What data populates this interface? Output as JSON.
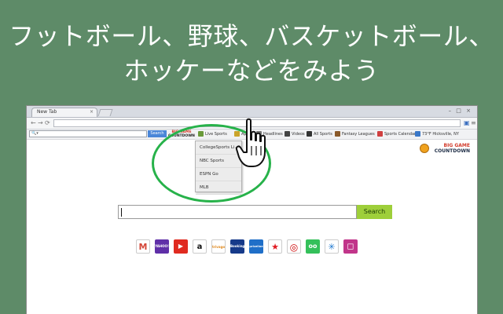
{
  "headline": {
    "line1": "フットボール、野球、バスケットボール、",
    "line2": "ホッケーなどをみよう"
  },
  "browser": {
    "tab_title": "New Tab",
    "tab_close": "×",
    "window_controls": "– □ ×"
  },
  "toolbar": {
    "search_placeholder": "🔍▾",
    "search_button": "Search",
    "logo_top": "BIG GAME",
    "logo_bottom": "COUNTDOWN",
    "items": [
      {
        "label": "Live Sports",
        "icon_color": "#6a9a3a"
      },
      {
        "label": "Apps",
        "icon_color": "#caa42b"
      },
      {
        "label": "Headlines",
        "icon_color": "#777777"
      },
      {
        "label": "Videos",
        "icon_color": "#444444"
      },
      {
        "label": "All Sports",
        "icon_color": "#333333"
      },
      {
        "label": "Fantasy Leagues",
        "icon_color": "#8a5a2a"
      },
      {
        "label": "Sports Calendar",
        "icon_color": "#d04040"
      },
      {
        "label": "73°F Hicksville, NY",
        "icon_color": "#3a78c8"
      }
    ]
  },
  "dropdown": {
    "items": [
      "CollegeSports Li...",
      "NBC Sports",
      "ESPN Go",
      "MLB"
    ]
  },
  "brand_logo": {
    "line1": "BIG GAME",
    "line2": "COUNTDOWN"
  },
  "main_search": {
    "button_label": "Search"
  },
  "shortcuts": [
    {
      "name": "gmail",
      "label": "M",
      "bg": "#ffffff",
      "fg": "#d44638"
    },
    {
      "name": "yahoo",
      "label": "YAHOO!",
      "bg": "#5f2fa8",
      "fg": "#ffffff"
    },
    {
      "name": "youtube",
      "label": "▶",
      "bg": "#e02a20",
      "fg": "#ffffff"
    },
    {
      "name": "amazon",
      "label": "a",
      "bg": "#ffffff",
      "fg": "#111111"
    },
    {
      "name": "trivago",
      "label": "trivago",
      "bg": "#ffffff",
      "fg": "#e08a20"
    },
    {
      "name": "booking",
      "label": "Booking",
      "bg": "#163a8a",
      "fg": "#ffffff"
    },
    {
      "name": "priceline",
      "label": "priceline",
      "bg": "#1f6fc8",
      "fg": "#ffffff"
    },
    {
      "name": "macys",
      "label": "★",
      "bg": "#ffffff",
      "fg": "#e01b22"
    },
    {
      "name": "target",
      "label": "◎",
      "bg": "#ffffff",
      "fg": "#cc0000"
    },
    {
      "name": "tripadvisor",
      "label": "oo",
      "bg": "#34c05a",
      "fg": "#ffffff"
    },
    {
      "name": "walmart",
      "label": "✳",
      "bg": "#ffffff",
      "fg": "#1a75cf"
    },
    {
      "name": "instagram",
      "label": "◻",
      "bg": "#c1358a",
      "fg": "#ffffff"
    }
  ]
}
